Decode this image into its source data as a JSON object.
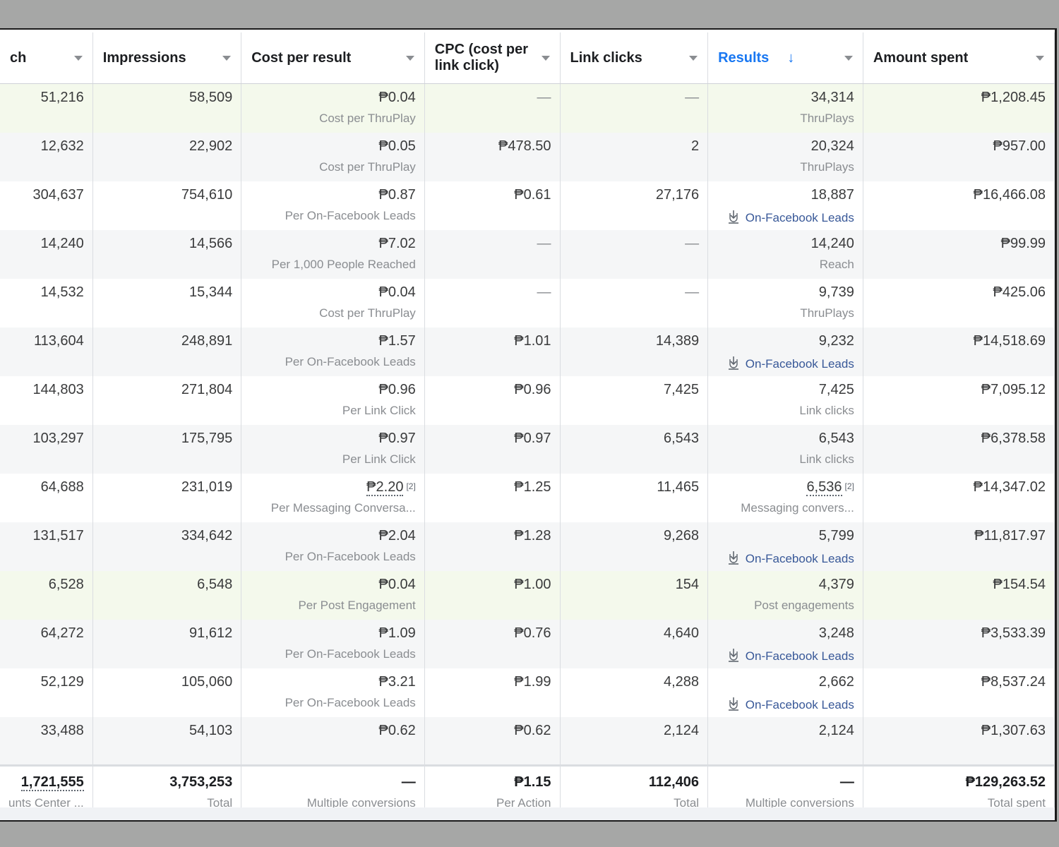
{
  "columns": [
    {
      "label": "ch",
      "sorted": false
    },
    {
      "label": "Impressions",
      "sorted": false
    },
    {
      "label": "Cost per result",
      "sorted": false
    },
    {
      "label": "CPC (cost per link click)",
      "sorted": false
    },
    {
      "label": "Link clicks",
      "sorted": false
    },
    {
      "label": "Results",
      "sorted": true,
      "arrow": "↓"
    },
    {
      "label": "Amount spent",
      "sorted": false
    }
  ],
  "rows": [
    {
      "highlight": true,
      "reach": "51,216",
      "impressions": "58,509",
      "cost": "₱0.04",
      "cost_sub": "Cost per ThruPlay",
      "cpc": "—",
      "clicks": "—",
      "results": "34,314",
      "results_sub": "ThruPlays",
      "results_link": false,
      "spent": "₱1,208.45"
    },
    {
      "highlight": false,
      "reach": "12,632",
      "impressions": "22,902",
      "cost": "₱0.05",
      "cost_sub": "Cost per ThruPlay",
      "cpc": "₱478.50",
      "clicks": "2",
      "results": "20,324",
      "results_sub": "ThruPlays",
      "results_link": false,
      "spent": "₱957.00"
    },
    {
      "highlight": false,
      "reach": "304,637",
      "impressions": "754,610",
      "cost": "₱0.87",
      "cost_sub": "Per On-Facebook Leads",
      "cpc": "₱0.61",
      "clicks": "27,176",
      "results": "18,887",
      "results_sub": "On-Facebook Leads",
      "results_link": true,
      "spent": "₱16,466.08"
    },
    {
      "highlight": false,
      "reach": "14,240",
      "impressions": "14,566",
      "cost": "₱7.02",
      "cost_sub": "Per 1,000 People Reached",
      "cpc": "—",
      "clicks": "—",
      "results": "14,240",
      "results_sub": "Reach",
      "results_link": false,
      "spent": "₱99.99"
    },
    {
      "highlight": false,
      "reach": "14,532",
      "impressions": "15,344",
      "cost": "₱0.04",
      "cost_sub": "Cost per ThruPlay",
      "cpc": "—",
      "clicks": "—",
      "results": "9,739",
      "results_sub": "ThruPlays",
      "results_link": false,
      "spent": "₱425.06"
    },
    {
      "highlight": false,
      "reach": "113,604",
      "impressions": "248,891",
      "cost": "₱1.57",
      "cost_sub": "Per On-Facebook Leads",
      "cpc": "₱1.01",
      "clicks": "14,389",
      "results": "9,232",
      "results_sub": "On-Facebook Leads",
      "results_link": true,
      "spent": "₱14,518.69"
    },
    {
      "highlight": false,
      "reach": "144,803",
      "impressions": "271,804",
      "cost": "₱0.96",
      "cost_sub": "Per Link Click",
      "cpc": "₱0.96",
      "clicks": "7,425",
      "results": "7,425",
      "results_sub": "Link clicks",
      "results_link": false,
      "spent": "₱7,095.12"
    },
    {
      "highlight": false,
      "reach": "103,297",
      "impressions": "175,795",
      "cost": "₱0.97",
      "cost_sub": "Per Link Click",
      "cpc": "₱0.97",
      "clicks": "6,543",
      "results": "6,543",
      "results_sub": "Link clicks",
      "results_link": false,
      "spent": "₱6,378.58"
    },
    {
      "highlight": false,
      "reach": "64,688",
      "impressions": "231,019",
      "cost": "₱2.20",
      "cost_fn": "[2]",
      "cost_sub": "Per Messaging Conversa...",
      "cpc": "₱1.25",
      "clicks": "11,465",
      "results": "6,536",
      "results_fn": "[2]",
      "results_sub": "Messaging convers...",
      "results_link": false,
      "spent": "₱14,347.02"
    },
    {
      "highlight": false,
      "reach": "131,517",
      "impressions": "334,642",
      "cost": "₱2.04",
      "cost_sub": "Per On-Facebook Leads",
      "cpc": "₱1.28",
      "clicks": "9,268",
      "results": "5,799",
      "results_sub": "On-Facebook Leads",
      "results_link": true,
      "spent": "₱11,817.97"
    },
    {
      "highlight": true,
      "reach": "6,528",
      "impressions": "6,548",
      "cost": "₱0.04",
      "cost_sub": "Per Post Engagement",
      "cpc": "₱1.00",
      "clicks": "154",
      "results": "4,379",
      "results_sub": "Post engagements",
      "results_link": false,
      "spent": "₱154.54"
    },
    {
      "highlight": false,
      "reach": "64,272",
      "impressions": "91,612",
      "cost": "₱1.09",
      "cost_sub": "Per On-Facebook Leads",
      "cpc": "₱0.76",
      "clicks": "4,640",
      "results": "3,248",
      "results_sub": "On-Facebook Leads",
      "results_link": true,
      "spent": "₱3,533.39"
    },
    {
      "highlight": false,
      "reach": "52,129",
      "impressions": "105,060",
      "cost": "₱3.21",
      "cost_sub": "Per On-Facebook Leads",
      "cpc": "₱1.99",
      "clicks": "4,288",
      "results": "2,662",
      "results_sub": "On-Facebook Leads",
      "results_link": true,
      "spent": "₱8,537.24"
    },
    {
      "highlight": false,
      "reach": "33,488",
      "impressions": "54,103",
      "cost": "₱0.62",
      "cost_sub": "",
      "cpc": "₱0.62",
      "clicks": "2,124",
      "results": "2,124",
      "results_sub": "",
      "results_link": false,
      "spent": "₱1,307.63"
    }
  ],
  "totals": {
    "reach": "1,721,555",
    "reach_sub": "unts Center ...",
    "impressions": "3,753,253",
    "impressions_sub": "Total",
    "cost": "—",
    "cost_sub": "Multiple conversions",
    "cpc": "₱1.15",
    "cpc_sub": "Per Action",
    "clicks": "112,406",
    "clicks_sub": "Total",
    "results": "—",
    "results_sub": "Multiple conversions",
    "spent": "₱129,263.52",
    "spent_sub": "Total spent"
  },
  "colors": {
    "accent": "#1877f2",
    "link": "#385898",
    "highlight_row": "#f4f9ec"
  }
}
